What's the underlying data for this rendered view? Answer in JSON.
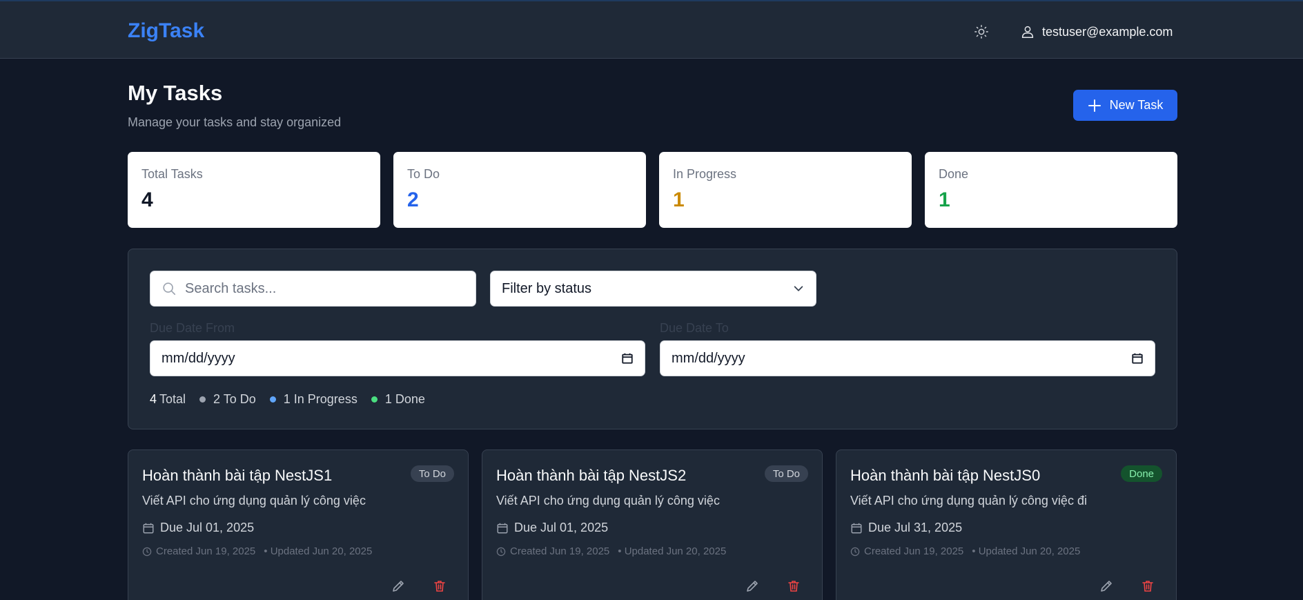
{
  "header": {
    "logo": "ZigTask",
    "user_email": "testuser@example.com"
  },
  "page": {
    "title": "My Tasks",
    "subtitle": "Manage your tasks and stay organized",
    "new_task_label": "New Task"
  },
  "stats": [
    {
      "label": "Total Tasks",
      "value": "4",
      "color": "#111827"
    },
    {
      "label": "To Do",
      "value": "2",
      "color": "#2563eb"
    },
    {
      "label": "In Progress",
      "value": "1",
      "color": "#ca8a04"
    },
    {
      "label": "Done",
      "value": "1",
      "color": "#16a34a"
    }
  ],
  "filters": {
    "search_placeholder": "Search tasks...",
    "status_select": "Filter by status",
    "due_from_label": "Due Date From",
    "due_to_label": "Due Date To",
    "due_from_value": "mm/dd/yyyy",
    "due_to_value": "mm/dd/yyyy"
  },
  "summary": {
    "total_num": "4",
    "total_label": "Total",
    "todo": "2 To Do",
    "in_progress": "1 In Progress",
    "done": "1 Done",
    "colors": {
      "todo": "#9ca3af",
      "in_progress": "#60a5fa",
      "done": "#4ade80"
    }
  },
  "tasks": [
    {
      "title": "Hoàn thành bài tập NestJS1",
      "status": "To Do",
      "description": "Viết API cho ứng dụng quản lý công việc",
      "due": "Due Jul 01, 2025",
      "created": "Created Jun 19, 2025",
      "updated": "• Updated Jun 20, 2025"
    },
    {
      "title": "Hoàn thành bài tập NestJS2",
      "status": "To Do",
      "description": "Viết API cho ứng dụng quản lý công việc",
      "due": "Due Jul 01, 2025",
      "created": "Created Jun 19, 2025",
      "updated": "• Updated Jun 20, 2025"
    },
    {
      "title": "Hoàn thành bài tập NestJS0",
      "status": "Done",
      "description": "Viết API cho ứng dụng quản lý công việc đi",
      "due": "Due Jul 31, 2025",
      "created": "Created Jun 19, 2025",
      "updated": "• Updated Jun 20, 2025"
    }
  ]
}
